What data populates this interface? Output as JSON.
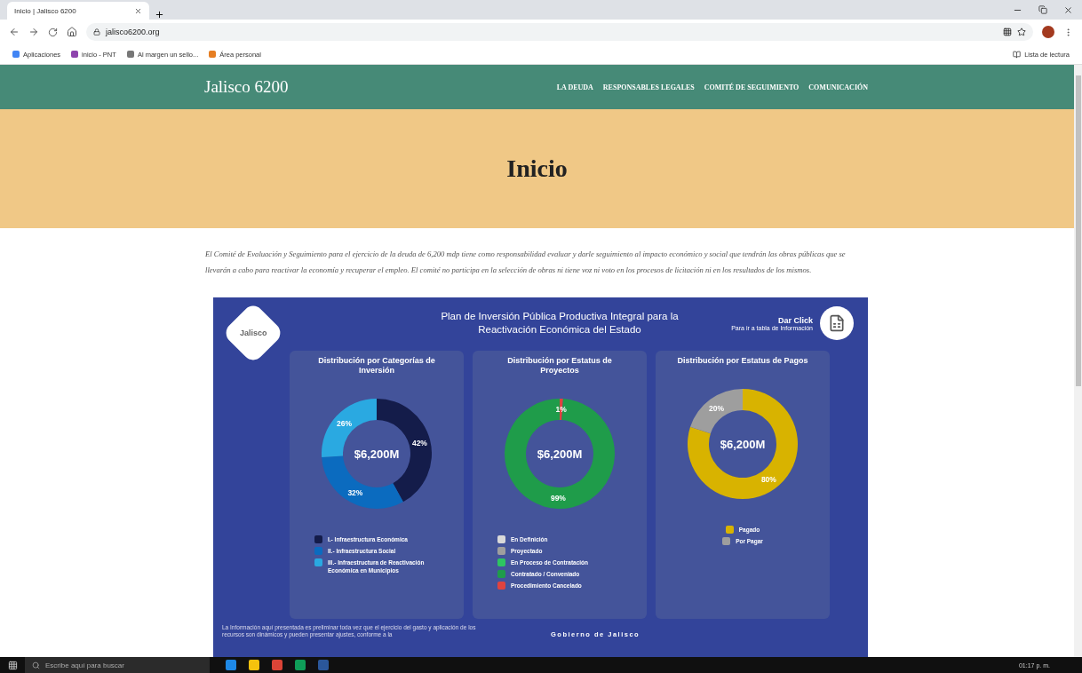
{
  "browser": {
    "tab_title": "Inicio | Jalisco 6200",
    "url": "jalisco6200.org",
    "bookmarks": [
      "Aplicaciones",
      "inicio - PNT",
      "Al margen un sello...",
      "Área personal"
    ],
    "reading_list": "Lista de lectura"
  },
  "site": {
    "brand": "Jalisco 6200",
    "nav": [
      "LA DEUDA",
      "RESPONSABLES LEGALES",
      "COMITÉ DE SEGUIMIENTO",
      "COMUNICACIÓN"
    ]
  },
  "hero": {
    "title": "Inicio"
  },
  "intro": "El Comité de Evaluación y Seguimiento para el ejercicio de la deuda de 6,200 mdp tiene como responsabilidad evaluar y darle seguimiento al impacto económico y social que tendrán las obras públicas que se llevarán a cabo para reactivar la economía y recuperar el empleo. El comité no participa en la selección de obras ni tiene voz ni voto en los procesos de licitación ni en los resultados de los mismos.",
  "dashboard": {
    "logo": "Jalisco",
    "title": "Plan de Inversión Pública Productiva Integral para la Reactivación Económica del Estado",
    "cta": "Dar Click",
    "cta_sub": "Para ir a tabla de Información",
    "panels": [
      {
        "title": "Distribución por Categorías de Inversión",
        "center": "$6,200M",
        "legend": [
          {
            "label": "I.- Infraestructura Económica",
            "color": "#141c4a"
          },
          {
            "label": "II.- Infraestructura Social",
            "color": "#0b6bbf"
          },
          {
            "label": "III.- Infraestructura de Reactivación Económica en Municipios",
            "color": "#2aa9e1"
          }
        ],
        "chart_data": {
          "type": "donut",
          "values": [
            42,
            32,
            26
          ],
          "colors": [
            "#141c4a",
            "#0b6bbf",
            "#2aa9e1"
          ],
          "value_labels": [
            "42%",
            "32%",
            "26%"
          ]
        }
      },
      {
        "title": "Distribución por Estatus de Proyectos",
        "center": "$6,200M",
        "legend": [
          {
            "label": "En Definición",
            "color": "#d9d9d9"
          },
          {
            "label": "Proyectado",
            "color": "#9e9e9e"
          },
          {
            "label": "En Proceso de Contratación",
            "color": "#2ec461"
          },
          {
            "label": "Contratado / Conveniado",
            "color": "#1f9c4a"
          },
          {
            "label": "Procedimiento Cancelado",
            "color": "#e0433f"
          }
        ],
        "chart_data": {
          "type": "donut",
          "values": [
            1,
            99
          ],
          "colors": [
            "#e0433f",
            "#1f9c4a"
          ],
          "value_labels": [
            "1%",
            "99%"
          ]
        }
      },
      {
        "title": "Distribución por Estatus de Pagos",
        "center": "$6,200M",
        "legend": [
          {
            "label": "Pagado",
            "color": "#d8b300"
          },
          {
            "label": "Por Pagar",
            "color": "#9e9e9e"
          }
        ],
        "chart_data": {
          "type": "donut",
          "values": [
            80,
            20
          ],
          "colors": [
            "#d8b300",
            "#9e9e9e"
          ],
          "value_labels": [
            "80%",
            "20%"
          ]
        }
      }
    ],
    "disclaimer": "La Información aquí presentada es preliminar toda vez que el ejercicio del gasto y aplicación de los recursos son dinámicos y pueden presentar ajustes, conforme a la",
    "footer": "Gobierno de Jalisco"
  },
  "taskbar": {
    "search_placeholder": "Escribe aquí para buscar",
    "time": "01:17 p. m."
  }
}
